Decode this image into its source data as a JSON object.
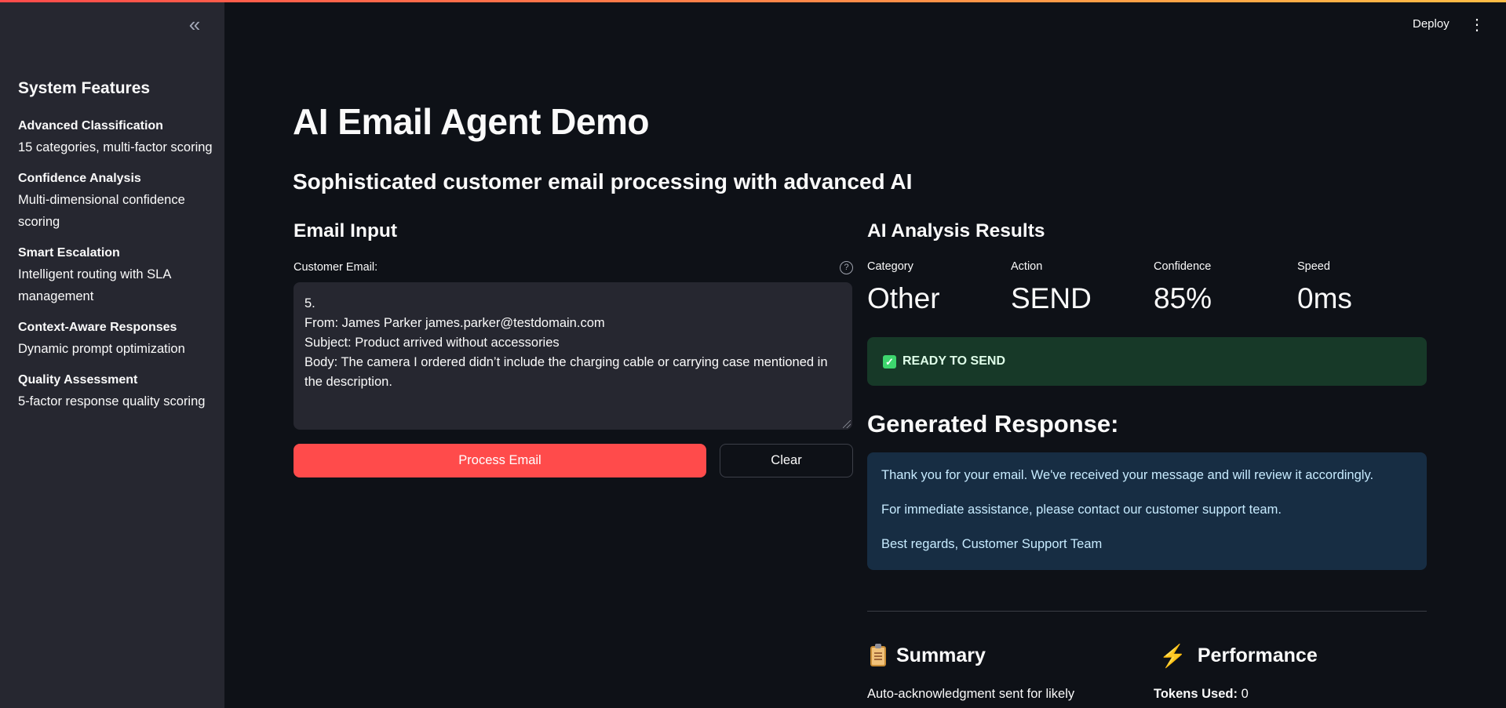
{
  "sidebar": {
    "collapse_icon": "chevrons-left-icon",
    "heading": "System Features",
    "features": [
      {
        "title": "Advanced Classification",
        "desc": "15 categories, multi-factor scoring"
      },
      {
        "title": "Confidence Analysis",
        "desc": "Multi-dimensional confidence scoring"
      },
      {
        "title": "Smart Escalation",
        "desc": "Intelligent routing with SLA management"
      },
      {
        "title": "Context-Aware Responses",
        "desc": "Dynamic prompt optimization"
      },
      {
        "title": "Quality Assessment",
        "desc": "5-factor response quality scoring"
      }
    ]
  },
  "header": {
    "deploy_label": "Deploy",
    "menu_icon": "kebab-menu-icon"
  },
  "main": {
    "title": "AI Email Agent Demo",
    "subtitle": "Sophisticated customer email processing with advanced AI"
  },
  "input": {
    "heading": "Email Input",
    "field_label": "Customer Email:",
    "help_glyph": "?",
    "email_value": "5.\nFrom: James Parker james.parker@testdomain.com\nSubject: Product arrived without accessories\nBody: The camera I ordered didn’t include the charging cable or carrying case mentioned in the description.",
    "process_label": "Process Email",
    "clear_label": "Clear"
  },
  "results": {
    "heading": "AI Analysis Results",
    "metrics": [
      {
        "label": "Category",
        "value": "Other"
      },
      {
        "label": "Action",
        "value": "SEND"
      },
      {
        "label": "Confidence",
        "value": "85%"
      },
      {
        "label": "Speed",
        "value": "0ms"
      }
    ],
    "status_text": "READY TO SEND",
    "status_color": "#173928",
    "response_heading": "Generated Response:",
    "response_paragraphs": [
      "Thank you for your email. We've received your message and will review it accordingly.",
      "For immediate assistance, please contact our customer support team.",
      "Best regards, Customer Support Team"
    ]
  },
  "summary": {
    "heading": "Summary",
    "icon": "clipboard-icon",
    "text": "Auto-acknowledgment sent for likely"
  },
  "performance": {
    "heading": "Performance",
    "icon": "lightning-icon",
    "tokens_label": "Tokens Used:",
    "tokens_value": "0"
  },
  "colors": {
    "accent": "#ff4b4b",
    "background": "#0e1117",
    "sidebar": "#262730",
    "info_box": "#172d43"
  }
}
